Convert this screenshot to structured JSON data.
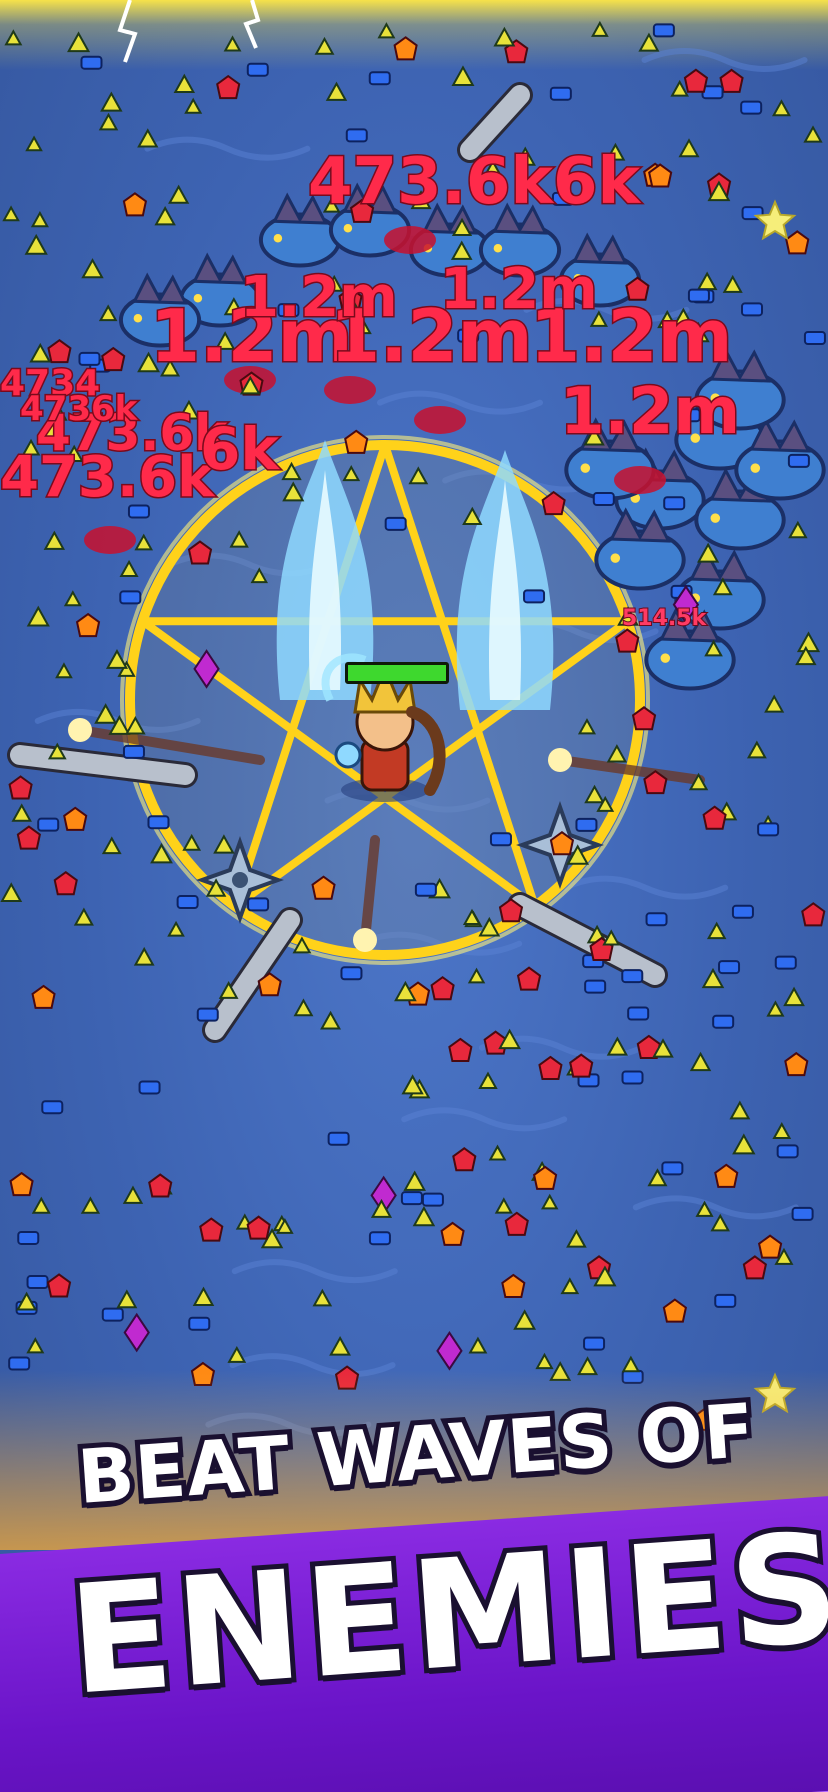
{
  "headline": {
    "line1": "BEAT WAVES OF",
    "line2": "ENEMIES"
  },
  "damage_numbers": [
    {
      "text": "473.6k6k"
    },
    {
      "text": "1.2m"
    },
    {
      "text": "1.2m"
    },
    {
      "text": "1.2m"
    },
    {
      "text": "1.2m"
    },
    {
      "text": "1.2m"
    },
    {
      "text": "1.2m"
    },
    {
      "text": "473.6k"
    },
    {
      "text": "473.6k"
    },
    {
      "text": "4734"
    },
    {
      "text": "4736k"
    },
    {
      "text": "6k"
    },
    {
      "text": "514.5k"
    }
  ],
  "player": {
    "health_fraction": 1.0
  },
  "colors": {
    "water": "#3f63b3",
    "banner": "#7a22d6",
    "damage_text": "#ff2a4a",
    "magic_circle": "#ffd21a",
    "health_bar": "#3ed82e",
    "xp_gem_yellow": "#e8e23a",
    "xp_gem_blue": "#2f6cf0",
    "gem_red": "#e8283c",
    "gem_orange": "#ff8a14",
    "gem_purple": "#c02ad0"
  }
}
